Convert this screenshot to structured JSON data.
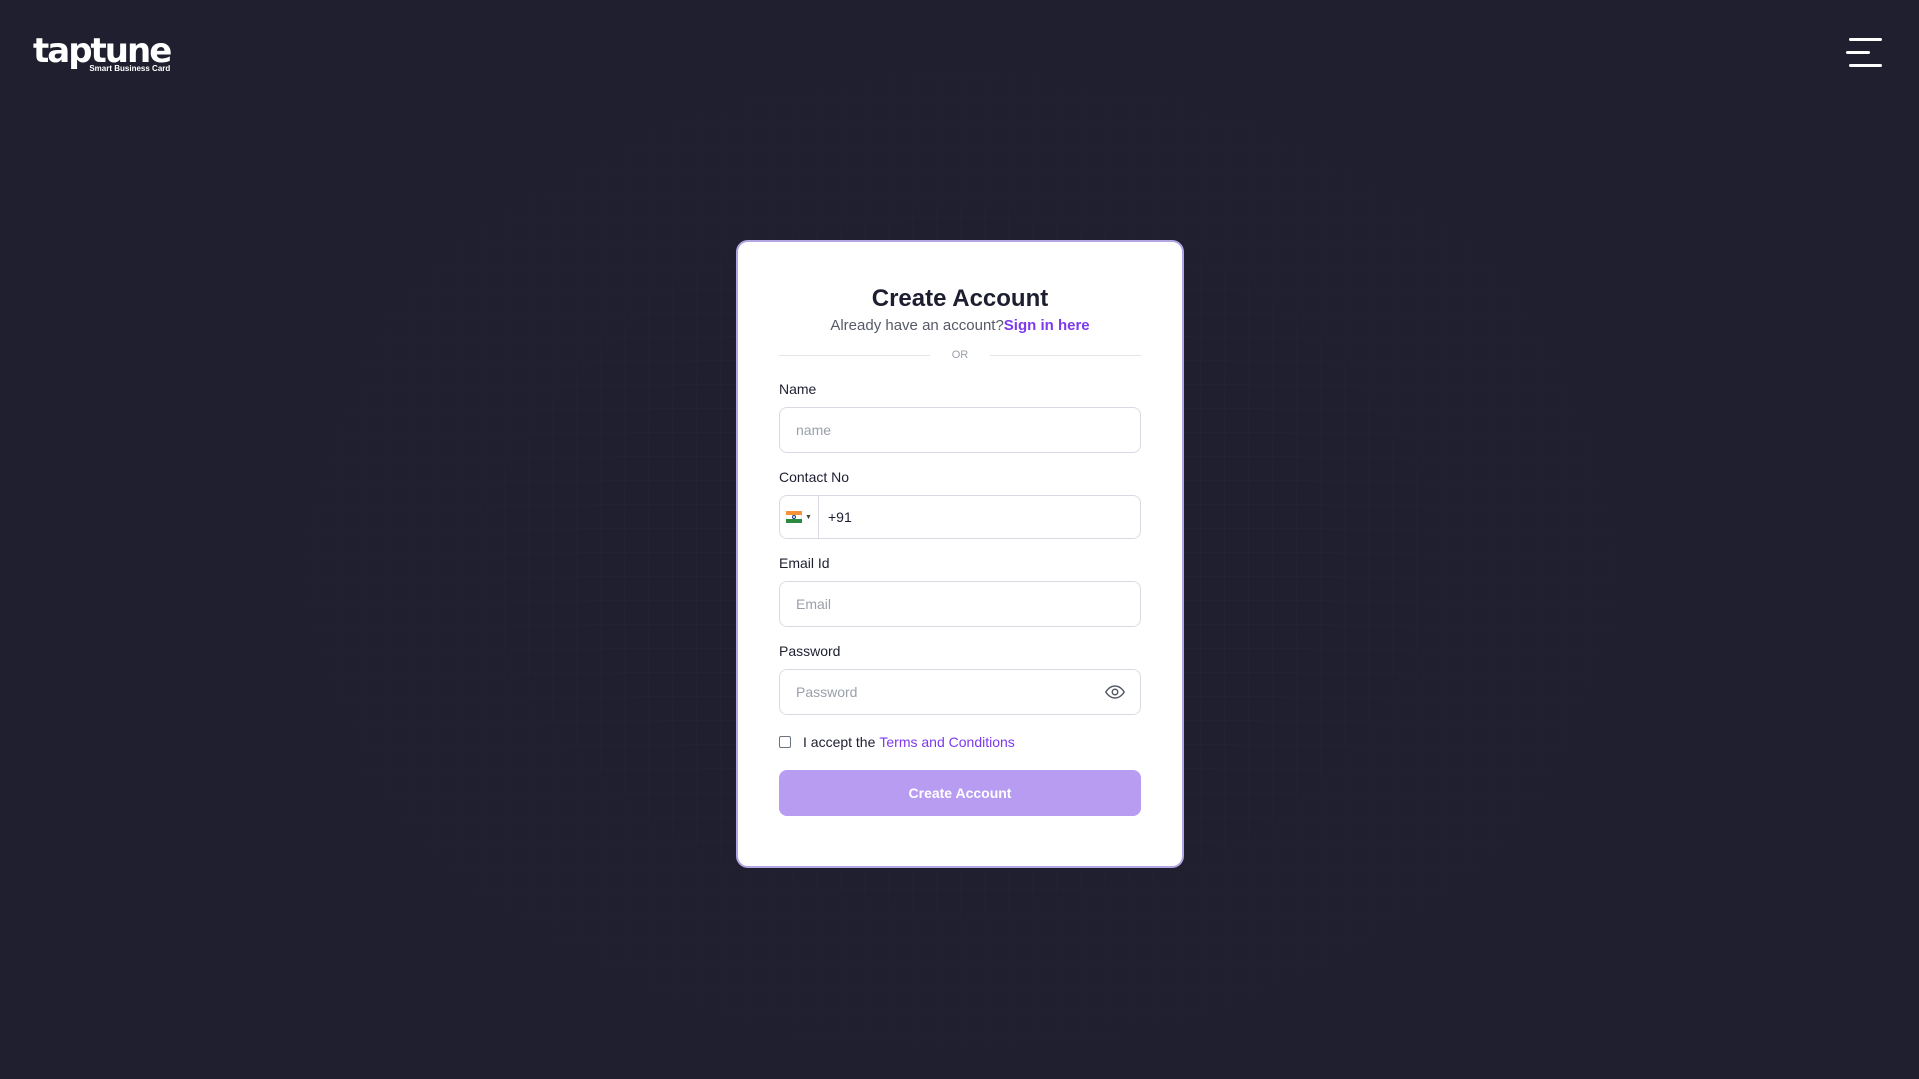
{
  "header": {
    "logo_text": "taptune",
    "logo_tagline": "Smart Business Card",
    "menu_icon": "hamburger-menu-icon"
  },
  "form": {
    "title": "Create Account",
    "subtitle_text": "Already have an account?",
    "signin_link": "Sign in here",
    "divider_text": "OR",
    "name_label": "Name",
    "name_placeholder": "name",
    "contact_label": "Contact No",
    "country_flag_icon": "india-flag-icon",
    "phone_value": "+91",
    "email_label": "Email Id",
    "email_placeholder": "Email",
    "password_label": "Password",
    "password_placeholder": "Password",
    "password_toggle_icon": "eye-icon",
    "terms_prefix": "I accept the",
    "terms_link": "Terms and Conditions",
    "terms_checked": false,
    "submit_label": "Create Account"
  },
  "colors": {
    "background": "#1f1f2f",
    "accent": "#7c3aed",
    "button": "#b79cf2",
    "card_border": "#b3a6e3"
  }
}
